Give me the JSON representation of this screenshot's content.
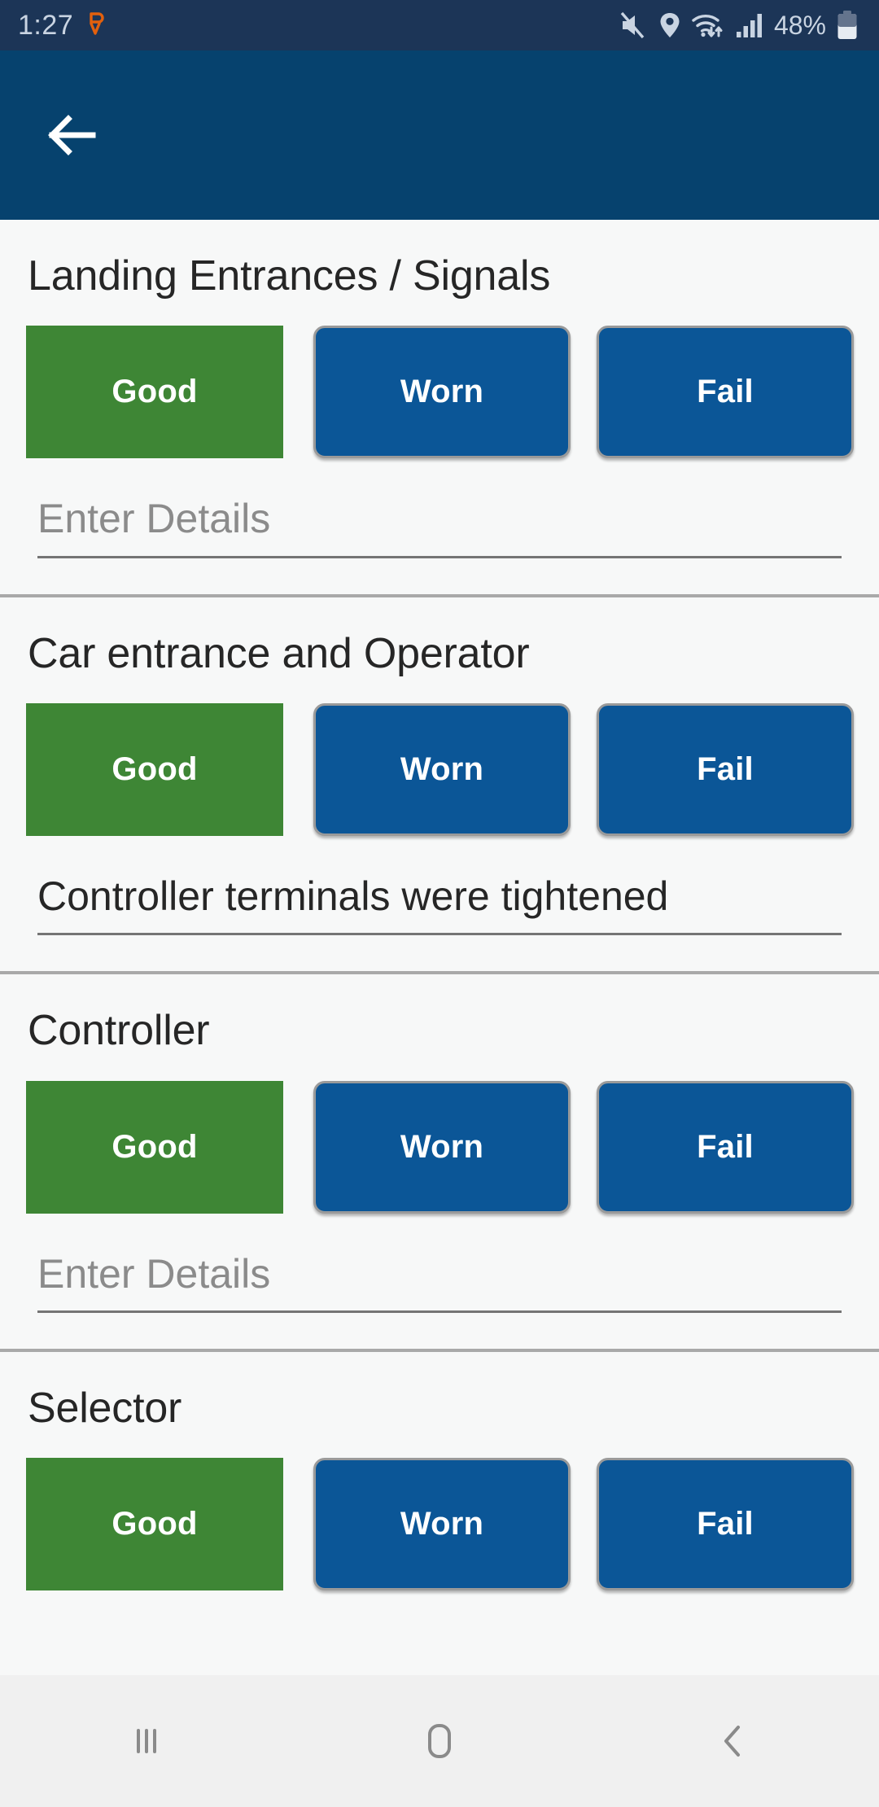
{
  "status_bar": {
    "time": "1:27",
    "alarm_icon": "alarm-icon",
    "icons": [
      "mute-icon",
      "location-icon",
      "wifi-icon",
      "signal-icon"
    ],
    "battery_text": "48%",
    "battery_icon": "battery-icon",
    "bg_color": "#1c3557",
    "fg_color": "#c9d4e2",
    "alarm_color": "#e2600d"
  },
  "app_bar": {
    "back_icon": "back-arrow-icon",
    "title": "",
    "bg_color": "#06426e"
  },
  "colors": {
    "selected_green": "#3e8635",
    "unselected_blue": "#0b5697",
    "page_bg": "#f7f8f8",
    "divider": "#a9a9a9",
    "placeholder": "#8b8b8b",
    "nav_bg": "#f0f0f0"
  },
  "options": {
    "good": "Good",
    "worn": "Worn",
    "fail": "Fail"
  },
  "details_placeholder": "Enter Details",
  "sections": [
    {
      "title": "Landing Entrances / Signals",
      "selected": "Good",
      "details_value": "",
      "details_placeholder": "Enter Details"
    },
    {
      "title": "Car entrance and Operator",
      "selected": "Good",
      "details_value": "Controller terminals were tightened",
      "details_placeholder": "Enter Details"
    },
    {
      "title": "Controller",
      "selected": "Good",
      "details_value": "",
      "details_placeholder": "Enter Details"
    },
    {
      "title": "Selector",
      "selected": "Good",
      "details_value": "",
      "details_placeholder": "Enter Details"
    }
  ],
  "nav_bar": {
    "recents": "recents-icon",
    "home": "home-icon",
    "back": "back-icon"
  }
}
